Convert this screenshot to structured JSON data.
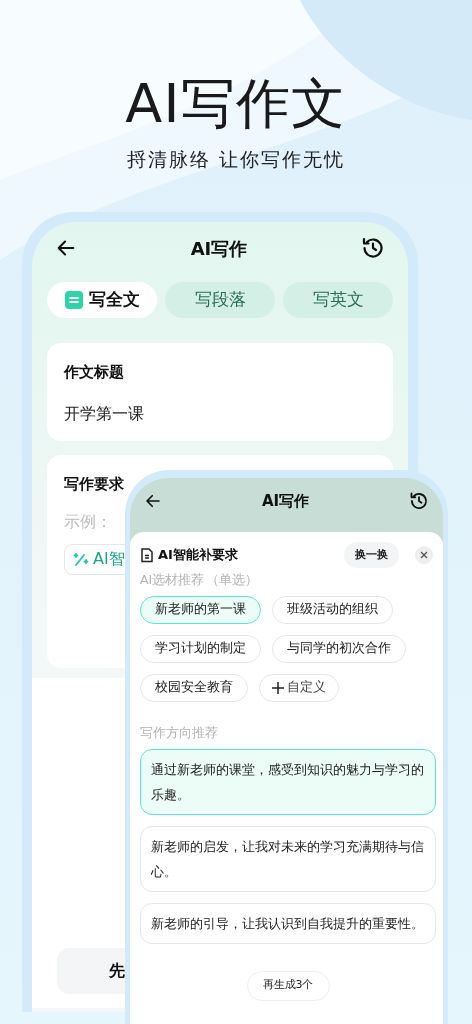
{
  "headline": {
    "title": "AI写作文",
    "subtitle": "捋清脉络 让你写作无忧"
  },
  "back_screen": {
    "title": "AI写作",
    "tabs": [
      {
        "label": "写全文",
        "selected": true
      },
      {
        "label": "写段落",
        "selected": false
      },
      {
        "label": "写英文",
        "selected": false
      }
    ],
    "title_card": {
      "label": "作文标题",
      "value": "开学第一课"
    },
    "requirements_card": {
      "label": "写作要求",
      "placeholder": "示例：",
      "ai_button": "AI智"
    },
    "bottom_button": "先"
  },
  "front_screen": {
    "title": "AI写作",
    "sheet": {
      "title": "AI智能补要求",
      "refresh_button": "换一换",
      "topics_label": "AI选材推荐",
      "topics_hint": "（单选）",
      "topics": [
        {
          "label": "新老师的第一课",
          "selected": true
        },
        {
          "label": "班级活动的组织",
          "selected": false
        },
        {
          "label": "学习计划的制定",
          "selected": false
        },
        {
          "label": "与同学的初次合作",
          "selected": false
        },
        {
          "label": "校园安全教育",
          "selected": false
        }
      ],
      "custom_button": "自定义",
      "directions_label": "写作方向推荐",
      "directions": [
        {
          "text": "通过新老师的课堂，感受到知识的魅力与学习的乐趣。",
          "selected": true
        },
        {
          "text": "新老师的启发，让我对未来的学习充满期待与信心。",
          "selected": false
        },
        {
          "text": "新老师的引导，让我认识到自我提升的重要性。",
          "selected": false
        }
      ],
      "regenerate_button": "再生成3个"
    }
  }
}
